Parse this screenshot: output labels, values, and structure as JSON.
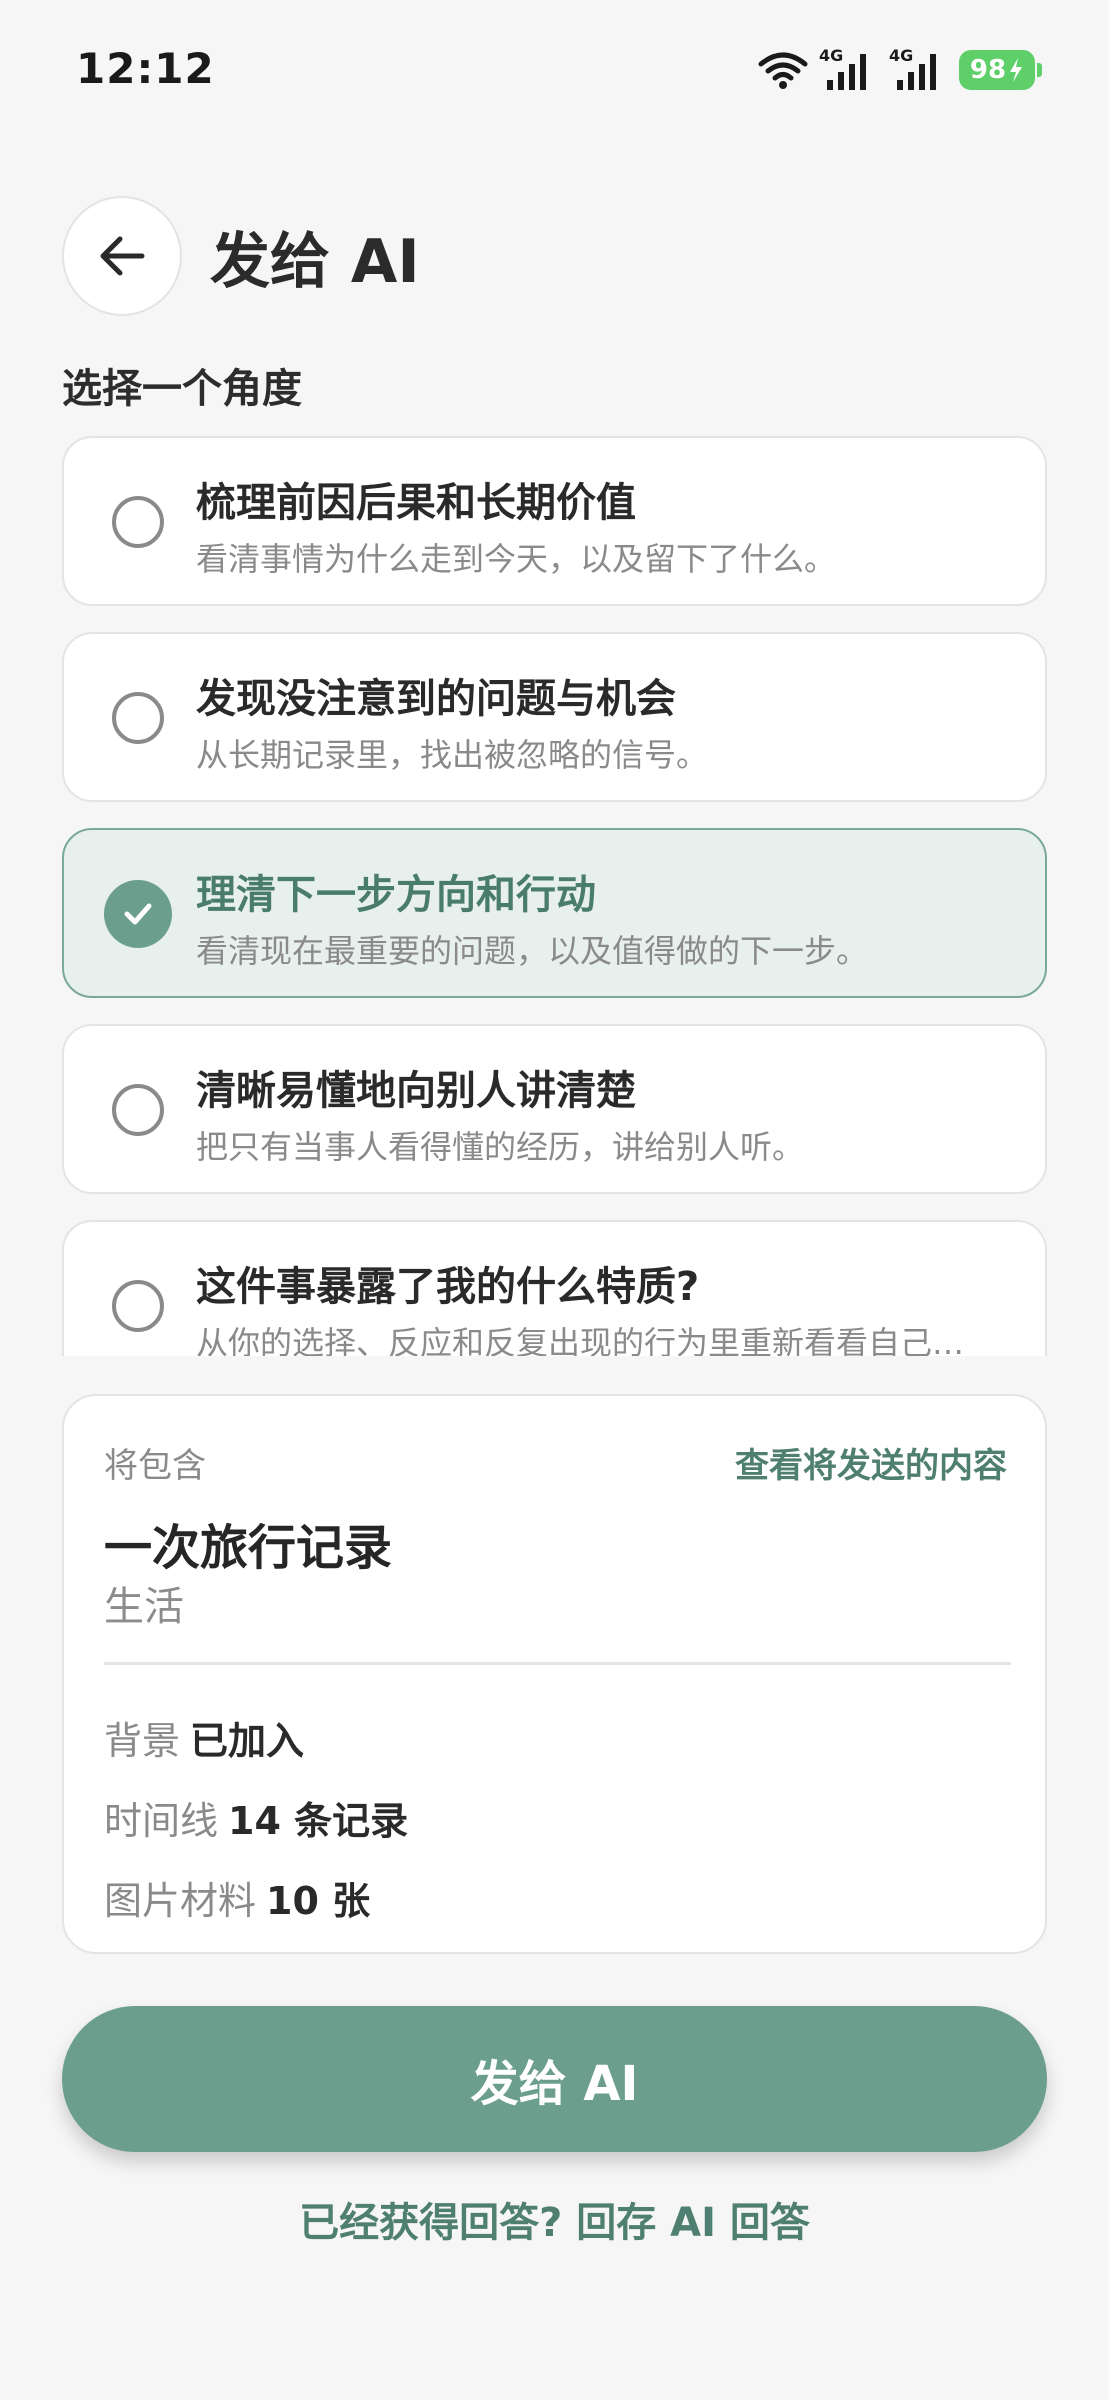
{
  "status_bar": {
    "time": "12:12",
    "network_1": "4G",
    "network_2": "4G",
    "battery": "98"
  },
  "header": {
    "title": "发给 AI"
  },
  "section_label": "选择一个角度",
  "options": [
    {
      "title": "梳理前因后果和长期价值",
      "desc": "看清事情为什么走到今天，以及留下了什么。",
      "selected": false
    },
    {
      "title": "发现没注意到的问题与机会",
      "desc": "从长期记录里，找出被忽略的信号。",
      "selected": false
    },
    {
      "title": "理清下一步方向和行动",
      "desc": "看清现在最重要的问题，以及值得做的下一步。",
      "selected": true
    },
    {
      "title": "清晰易懂地向别人讲清楚",
      "desc": "把只有当事人看得懂的经历，讲给别人听。",
      "selected": false
    },
    {
      "title": "这件事暴露了我的什么特质?",
      "desc": "从你的选择、反应和反复出现的行为里重新看看自己…",
      "selected": false
    }
  ],
  "summary": {
    "label": "将包含",
    "view_link": "查看将发送的内容",
    "record_title": "一次旅行记录",
    "record_category": "生活",
    "stats": [
      {
        "key": "背景",
        "value": "已加入"
      },
      {
        "key": "时间线",
        "value": "14 条记录"
      },
      {
        "key": "图片材料",
        "value": "10 张"
      }
    ]
  },
  "send_button": "发给 AI",
  "save_answer_link": "已经获得回答? 回存 AI 回答",
  "colors": {
    "accent": "#6b9e8c",
    "accent_text": "#4f7f70",
    "selected_bg": "#e7f0ec",
    "battery": "#5fcf6a"
  }
}
